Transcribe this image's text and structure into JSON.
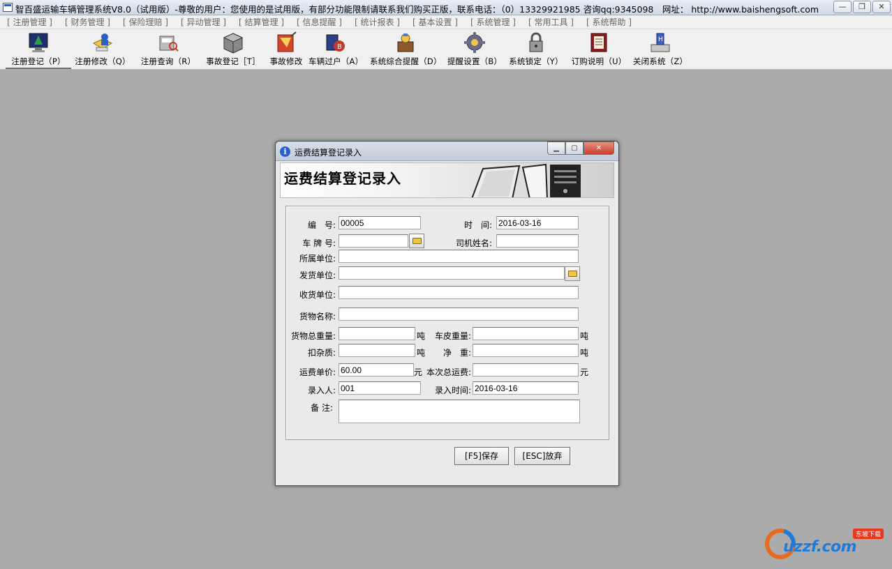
{
  "window": {
    "title": "智百盛运输车辆管理系统V8.0（试用版）-尊敬的用户：您使用的是试用版，有部分功能限制请联系我们购买正版，联系电话：（0）13329921985 咨询qq:9345098　网址： http://www.baishengsoft.com",
    "controls": [
      "—",
      "❐",
      "✕"
    ]
  },
  "menu": [
    "[ 注册管理 ]",
    "[ 财务管理 ]",
    "[ 保险理赔 ]",
    "[ 异动管理 ]",
    "[ 结算管理 ]",
    "[ 信息提醒 ]",
    "[ 统计报表 ]",
    "[ 基本设置 ]",
    "[ 系统管理 ]",
    "[ 常用工具 ]",
    "[ 系统帮助 ]"
  ],
  "toolbar": [
    {
      "label": "注册登记（P）",
      "icon": "monitor-register-icon"
    },
    {
      "label": "注册修改（Q）",
      "icon": "edit-user-icon"
    },
    {
      "label": "注册查询（R）",
      "icon": "search-query-icon"
    },
    {
      "label": "事故登记［T］",
      "icon": "accident-box-icon"
    },
    {
      "label": "事故修改",
      "icon": "accident-edit-icon"
    },
    {
      "label": "车辆过户（A）",
      "icon": "transfer-icon"
    },
    {
      "label": "系统综合提醒（D）",
      "icon": "reminder-icon"
    },
    {
      "label": "提醒设置（B）",
      "icon": "settings-gear-icon"
    },
    {
      "label": "系统锁定（Y）",
      "icon": "lock-icon"
    },
    {
      "label": "订购说明（U）",
      "icon": "book-icon"
    },
    {
      "label": "关闭系统（Z）",
      "icon": "shutdown-icon"
    }
  ],
  "dialog": {
    "title": "运费结算登记录入",
    "banner_title": "运费结算登记录入",
    "fields": {
      "number": {
        "label": "编　号:",
        "value": "00005"
      },
      "time": {
        "label": "时　间:",
        "value": "2016-03-16"
      },
      "plate": {
        "label": "车 牌 号:",
        "value": ""
      },
      "driver": {
        "label": "司机姓名:",
        "value": ""
      },
      "unit": {
        "label": "所属单位:",
        "value": ""
      },
      "shipper": {
        "label": "发货单位:",
        "value": ""
      },
      "receiver": {
        "label": "收货单位:",
        "value": ""
      },
      "goods": {
        "label": "货物名称:",
        "value": ""
      },
      "gross_weight": {
        "label": "货物总重量:",
        "value": "",
        "unit": "吨"
      },
      "tare_weight": {
        "label": "车皮重量:",
        "value": "",
        "unit": "吨"
      },
      "impurity": {
        "label": "扣杂质:",
        "value": "",
        "unit": "吨"
      },
      "net_weight": {
        "label": "净　重:",
        "value": "",
        "unit": "吨"
      },
      "unit_price": {
        "label": "运费单价:",
        "value": "60.00",
        "unit": "元"
      },
      "total_fee": {
        "label": "本次总运费:",
        "value": "",
        "unit": "元"
      },
      "entered_by": {
        "label": "录入人:",
        "value": "001"
      },
      "entry_time": {
        "label": "录入时间:",
        "value": "2016-03-16"
      },
      "remark": {
        "label": "备 注:",
        "value": ""
      }
    },
    "buttons": {
      "save": "[F5]保存",
      "cancel": "[ESC]放弃"
    }
  },
  "watermark": {
    "brand": "uzzf.com",
    "badge": "东坡下载"
  }
}
